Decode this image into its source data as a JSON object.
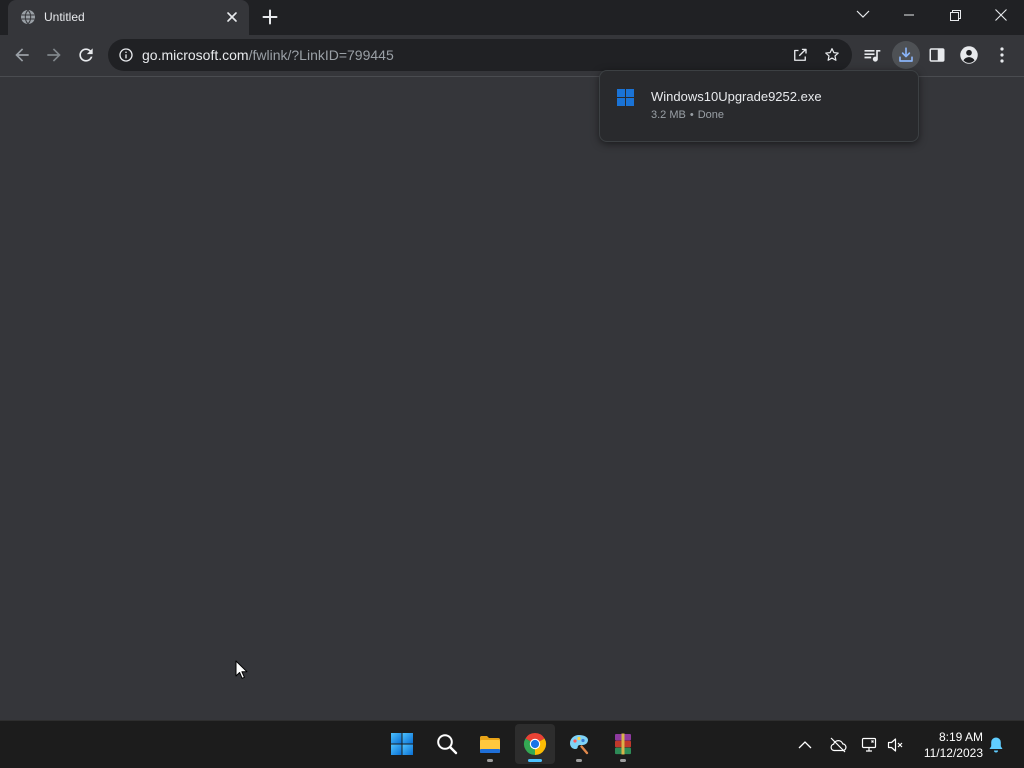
{
  "browser": {
    "tab": {
      "title": "Untitled",
      "favicon_icon": "globe-icon",
      "close_icon": "close-icon"
    },
    "new_tab_icon": "plus-icon",
    "window_controls": {
      "tab_search_icon": "chevron-down-icon",
      "minimize_icon": "minimize-icon",
      "restore_icon": "restore-icon",
      "close_icon": "close-icon"
    },
    "toolbar": {
      "back_icon": "arrow-left-icon",
      "forward_icon": "arrow-right-icon",
      "reload_icon": "reload-icon",
      "site_info_icon": "info-icon",
      "share_icon": "share-icon",
      "bookmark_icon": "star-icon",
      "media_controls_icon": "queue-music-icon",
      "downloads_icon": "download-icon",
      "side_panel_icon": "side-panel-icon",
      "profile_icon": "profile-icon",
      "menu_icon": "more-vert-icon"
    },
    "address_bar": {
      "domain": "go.microsoft.com",
      "path": "/fwlink/?LinkID=799445"
    }
  },
  "downloads_bubble": {
    "items": [
      {
        "icon": "windows-logo-icon",
        "filename": "Windows10Upgrade9252.exe",
        "size": "3.2 MB",
        "separator": "•",
        "status": "Done"
      }
    ]
  },
  "taskbar": {
    "apps": [
      {
        "icon": "start-icon",
        "running": false,
        "active": false
      },
      {
        "icon": "search-icon",
        "running": false,
        "active": false
      },
      {
        "icon": "file-explorer-icon",
        "running": true,
        "active": false
      },
      {
        "icon": "chrome-icon",
        "running": true,
        "active": true
      },
      {
        "icon": "paint-icon",
        "running": true,
        "active": false
      },
      {
        "icon": "winrar-icon",
        "running": true,
        "active": false
      }
    ],
    "tray": {
      "overflow_icon": "chevron-up-icon",
      "onedrive_icon": "cloud-offline-icon",
      "network_icon": "network-icon",
      "volume_icon": "volume-muted-icon",
      "notifications_icon": "bell-icon"
    },
    "clock": {
      "time": "8:19 AM",
      "date": "11/12/2023"
    }
  },
  "colors": {
    "tab_strip_bg": "#202124",
    "toolbar_bg": "#35363a",
    "page_bg": "#35363a",
    "omnibox_bg": "#202124",
    "accent": "#8ab4f8",
    "taskbar_bg": "#1c1c1c",
    "taskbar_active_indicator": "#4cc2ff"
  }
}
